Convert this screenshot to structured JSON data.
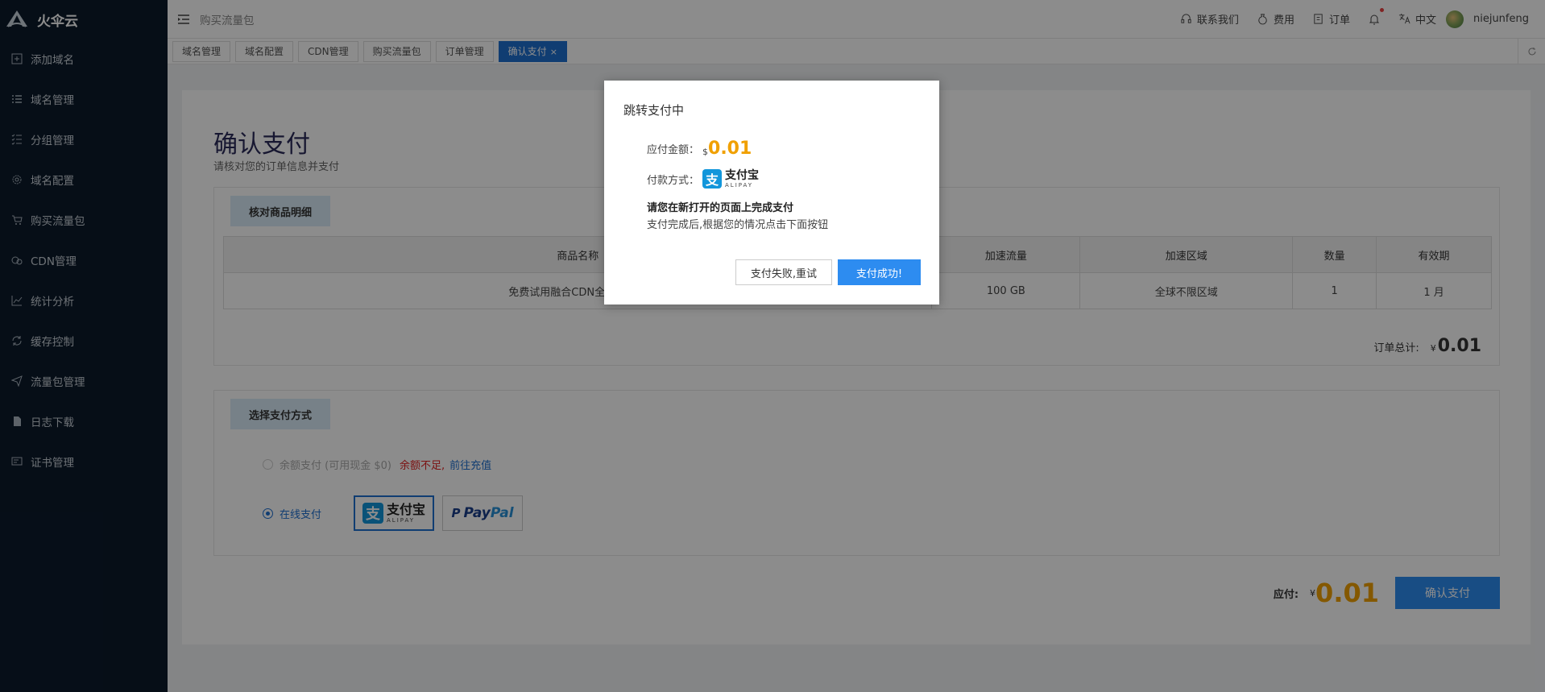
{
  "app": {
    "name": "火伞云"
  },
  "sidebar": {
    "items": [
      {
        "label": "添加域名",
        "icon": "plus-square-icon"
      },
      {
        "label": "域名管理",
        "icon": "list-icon"
      },
      {
        "label": "分组管理",
        "icon": "list-check-icon"
      },
      {
        "label": "域名配置",
        "icon": "gear-icon"
      },
      {
        "label": "购买流量包",
        "icon": "cart-icon"
      },
      {
        "label": "CDN管理",
        "icon": "cdn-icon"
      },
      {
        "label": "统计分析",
        "icon": "chart-icon"
      },
      {
        "label": "缓存控制",
        "icon": "refresh-icon"
      },
      {
        "label": "流量包管理",
        "icon": "send-icon"
      },
      {
        "label": "日志下载",
        "icon": "file-icon"
      },
      {
        "label": "证书管理",
        "icon": "certificate-icon"
      }
    ]
  },
  "topbar": {
    "breadcrumb": "购买流量包",
    "contact": "联系我们",
    "billing": "费用",
    "orders": "订单",
    "language": "中文",
    "username": "niejunfeng"
  },
  "tabs": [
    {
      "label": "域名管理"
    },
    {
      "label": "域名配置"
    },
    {
      "label": "CDN管理"
    },
    {
      "label": "购买流量包"
    },
    {
      "label": "订单管理"
    },
    {
      "label": "确认支付",
      "close": "×"
    }
  ],
  "page": {
    "title": "确认支付",
    "subtitle": "请核对您的订单信息并支付",
    "goods_section": "核对商品明细",
    "table": {
      "headers": [
        "商品名称",
        "加速流量",
        "加速区域",
        "数量",
        "有效期"
      ],
      "row": [
        "免费试用融合CDN全球不限区",
        "100 GB",
        "全球不限区域",
        "1",
        "1 月"
      ]
    },
    "order_total_label": "订单总计:",
    "order_total_currency": "¥",
    "order_total": "0.01",
    "pay_section": "选择支付方式",
    "balance_option": "余额支付 (可用现金 $0)",
    "balance_warning": "余额不足,",
    "recharge_link": "前往充值",
    "online_option": "在线支付",
    "alipay_cn": "支付宝",
    "alipay_en": "ALIPAY",
    "paypal_pay": "Pay",
    "paypal_pal": "Pal",
    "due_label": "应付:",
    "due_currency": "¥",
    "due_amount": "0.01",
    "confirm_button": "确认支付"
  },
  "modal": {
    "title": "跳转支付中",
    "amount_label": "应付金额：",
    "amount_currency": "$",
    "amount": "0.01",
    "method_label": "付款方式：",
    "method_cn": "支付宝",
    "method_en": "ALIPAY",
    "instruction": "请您在新打开的页面上完成支付",
    "note": "支付完成后,根据您的情况点击下面按钮",
    "fail_button": "支付失败,重试",
    "success_button": "支付成功!"
  },
  "colors": {
    "accent": "#1e6fd0",
    "amount": "#f0a000",
    "sidebar": "#0b1a2b",
    "warning": "#e02020"
  }
}
